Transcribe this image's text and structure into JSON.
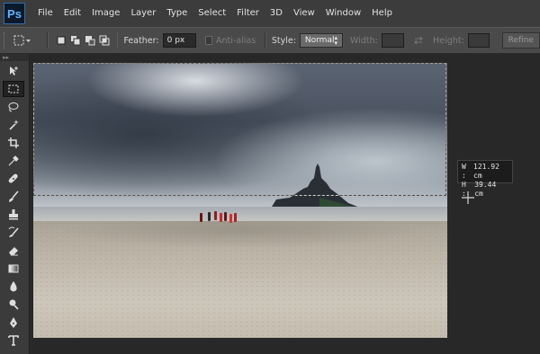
{
  "app": {
    "logo": "Ps"
  },
  "menu": [
    "File",
    "Edit",
    "Image",
    "Layer",
    "Type",
    "Select",
    "Filter",
    "3D",
    "View",
    "Window",
    "Help"
  ],
  "options": {
    "feather_label": "Feather:",
    "feather_value": "0 px",
    "antialias_label": "Anti-alias",
    "style_label": "Style:",
    "style_value": "Normal",
    "width_label": "Width:",
    "height_label": "Height:",
    "refine_label": "Refine"
  },
  "tools": [
    "move-tool-icon",
    "rectangular-marquee-icon",
    "lasso-icon",
    "magic-wand-icon",
    "crop-icon",
    "eyedropper-icon",
    "healing-brush-icon",
    "brush-icon",
    "clone-stamp-icon",
    "history-brush-icon",
    "eraser-icon",
    "gradient-icon",
    "blur-icon",
    "dodge-icon",
    "pen-icon",
    "type-icon"
  ],
  "selection_info": {
    "w_label": "W :",
    "w_value": "121.92 cm",
    "h_label": "H :",
    "h_value": "39.44 cm"
  },
  "colors": {
    "menubar_bg": "#3c3c3c",
    "optionsbar_bg": "#4a4a4a",
    "workspace_bg": "#282828",
    "ps_logo_blue": "#5fb4ff"
  }
}
